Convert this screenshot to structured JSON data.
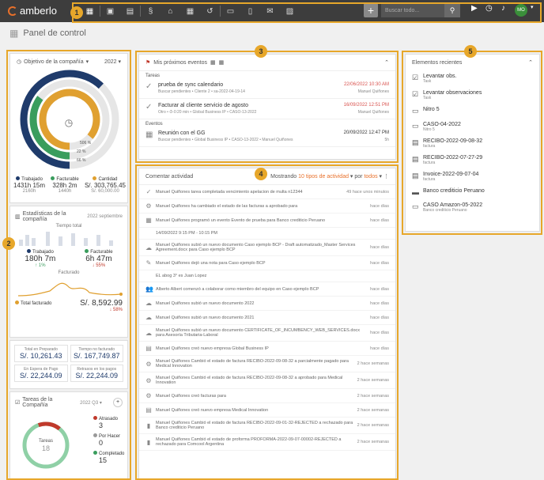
{
  "app": {
    "name": "amberlo"
  },
  "topbar": {
    "search_placeholder": "Buscar todo...",
    "avatar": "MO"
  },
  "page": {
    "title": "Panel de control"
  },
  "callouts": [
    "1",
    "2",
    "3",
    "4",
    "5"
  ],
  "objective": {
    "title": "Objetivo de la compañía",
    "year": "2022",
    "pct1": "506 %",
    "pct2": "22 %",
    "pct3": "66 %",
    "legend": [
      {
        "label": "Trabajado",
        "color": "#1f3b6b",
        "value": "1431h 15m",
        "sub": "2160h"
      },
      {
        "label": "Facturable",
        "color": "#3a9d5d",
        "value": "328h 2m",
        "sub": "1440h"
      },
      {
        "label": "Cantidad",
        "color": "#e0a030",
        "value": "S/. 303,765.45",
        "sub": "S/. 60,000.00"
      }
    ],
    "fills": [
      0.62,
      0.35,
      0.86
    ]
  },
  "stats": {
    "title": "Estadísticas de la compañía",
    "month": "2022 septiembre",
    "chart_title": "Tiempo total",
    "worked_label": "Trabajado",
    "worked_value": "180h 7m",
    "worked_delta": "1%",
    "billable_label": "Facturable",
    "billable_value": "6h 47m",
    "billable_delta": "55%",
    "billed_label": "Facturado",
    "total_label": "Total facturado",
    "total_value": "S/. 8,592.99",
    "total_delta": "58%"
  },
  "money": [
    {
      "label": "Total en Preparado",
      "value": "S/. 10,261.43"
    },
    {
      "label": "Tiempo no facturado",
      "value": "S/. 167,749.87"
    },
    {
      "label": "En Espera de Pago",
      "value": "S/. 22,244.09"
    },
    {
      "label": "Retrasos en los pagos",
      "value": "S/. 22,244.09"
    }
  ],
  "tasks": {
    "title": "Tareas de la Compañía",
    "quarter": "2022 Q3",
    "center_label": "Tareas",
    "center_value": "18",
    "items": [
      {
        "label": "Atrasado",
        "value": "3",
        "color": "#c0392b"
      },
      {
        "label": "Por Hacer",
        "value": "0",
        "color": "#999999"
      },
      {
        "label": "Completado",
        "value": "15",
        "color": "#3a9d5d"
      }
    ]
  },
  "events": {
    "title": "Mis próximos eventos",
    "tasks_label": "Tareas",
    "events_label": "Eventos",
    "items": [
      {
        "title": "prueba de sync calendario",
        "sub": "Buscar pendientes • Cliente 2 • sa-2022-04-19-14",
        "date": "22/06/2022 10:30 AM",
        "who": "Manuel Quiñones",
        "overdue": true,
        "icon": "✓"
      },
      {
        "title": "Facturar al cliente servicio de agosto",
        "sub": "Otro • ⏱-0:20 min • Global Business IP • CASO-13-2022",
        "date": "16/09/2022 12:51 PM",
        "who": "Manuel Quiñones",
        "overdue": true,
        "icon": "✓"
      },
      {
        "title": "Reunión con el GG",
        "sub": "Buscar pendientes • Global Business IP • CASO-13-2022 • Manuel Quiñones",
        "date": "20/09/2022 12:47 PM",
        "who": "5h",
        "overdue": false,
        "icon": "▦"
      }
    ]
  },
  "activity": {
    "title": "Comentar actividad",
    "showing": "Mostrando",
    "filter": "10 tipos de actividad",
    "by": "por",
    "who": "todos",
    "items": [
      {
        "text": "Manuel Quiñones tarea completada vencimiento apelacion de multa n12344",
        "when": "49 hace unos minutos",
        "icon": "✓"
      },
      {
        "text": "Manuel Quiñones ha cambiado el estado de las facturas a aprobado para",
        "when": "hace días",
        "icon": "⚙"
      },
      {
        "text": "Manuel Quiñones programó un evento Evento de prueba para Banco crediticio Peruano",
        "when": "hace días",
        "icon": "▦"
      },
      {
        "text": "14/09/2022 9:15 PM - 10:15 PM",
        "when": "",
        "icon": ""
      },
      {
        "text": "Manuel Quiñones subió un nuevo documento Caso ejemplo BCP - Draft automatizado_Master Services Agreement.docx para Caso ejemplo BCP",
        "when": "hace días",
        "icon": "☁"
      },
      {
        "text": "Manuel Quiñones dejó una nota para Caso ejemplo BCP",
        "when": "hace días",
        "icon": "✎"
      },
      {
        "text": "EL abog 3° es Juan Lopez",
        "when": "",
        "icon": ""
      },
      {
        "text": "Alberto Albert comenzó a colaborar como miembro del equipo en Caso ejemplo BCP",
        "when": "hace días",
        "icon": "👥"
      },
      {
        "text": "Manuel Quiñones subió un nuevo documento 2022",
        "when": "hace días",
        "icon": "☁"
      },
      {
        "text": "Manuel Quiñones subió un nuevo documento 2021",
        "when": "hace días",
        "icon": "☁"
      },
      {
        "text": "Manuel Quiñones subió un nuevo documento CERTIFICATE_OF_INCUMBENCY_WEB_SERVICES.docx para Asesoría Tributaria-Laboral",
        "when": "hace días",
        "icon": "☁"
      },
      {
        "text": "Manuel Quiñones creó nuevo empresa Global Business IP",
        "when": "hace días",
        "icon": "▤"
      },
      {
        "text": "Manuel Quiñones Cambió el estado de factura RECIBO-2022-09-08-32 a parcialmente pagado para Medical Innovation",
        "when": "2 hace semanas",
        "icon": "⚙"
      },
      {
        "text": "Manuel Quiñones Cambió el estado de factura RECIBO-2022-09-08-32 a aprobado para Medical Innovation",
        "when": "2 hace semanas",
        "icon": "⚙"
      },
      {
        "text": "Manuel Quiñones creó facturas para",
        "when": "2 hace semanas",
        "icon": "⚙"
      },
      {
        "text": "Manuel Quiñones creó nuevo empresa Medical Innovation",
        "when": "2 hace semanas",
        "icon": "▤"
      },
      {
        "text": "Manuel Quiñones Cambió el estado de factura RECIBO-2022-09-01-32-REJECTED a rechazado para Banco crediticio Peruano",
        "when": "2 hace semanas",
        "icon": "▮"
      },
      {
        "text": "Manuel Quiñones Cambió el estado de proforma PROFORMA-2022-09-07-00002-REJECTED a rechazado para Comcool Argentina",
        "when": "2 hace semanas",
        "icon": "▮"
      }
    ]
  },
  "recent": {
    "title": "Elementos recientes",
    "items": [
      {
        "title": "Levantar obs.",
        "sub": "Task",
        "icon": "check"
      },
      {
        "title": "Levantar observaciones",
        "sub": "Task",
        "icon": "check"
      },
      {
        "title": "Nitro 5",
        "sub": "",
        "icon": "case"
      },
      {
        "title": "CASO-04-2022",
        "sub": "Nitro 5",
        "icon": "case"
      },
      {
        "title": "RECIBO-2022-09-08-32",
        "sub": "factura",
        "icon": "doc"
      },
      {
        "title": "RECIBO-2022-07-27-29",
        "sub": "factura",
        "icon": "doc"
      },
      {
        "title": "Invoice-2022-09-07-04",
        "sub": "factura",
        "icon": "doc"
      },
      {
        "title": "Banco crediticio Peruano",
        "sub": "",
        "icon": "folder"
      },
      {
        "title": "CASO Amazon-05-2022",
        "sub": "Banco crediticio Peruano",
        "icon": "case"
      }
    ]
  }
}
